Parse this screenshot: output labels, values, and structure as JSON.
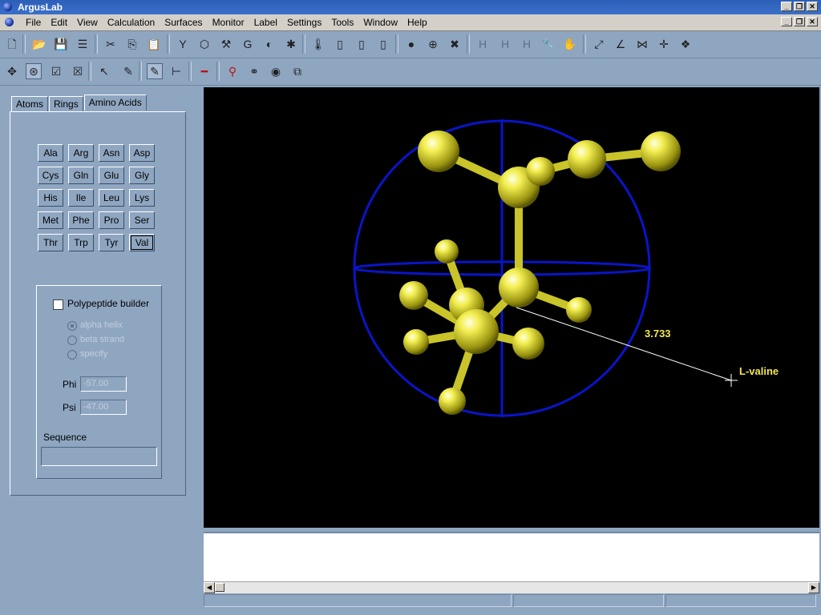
{
  "app": {
    "title": "ArgusLab"
  },
  "window_buttons": [
    "_",
    "❐",
    "✕"
  ],
  "menu": [
    "File",
    "Edit",
    "View",
    "Calculation",
    "Surfaces",
    "Monitor",
    "Label",
    "Settings",
    "Tools",
    "Window",
    "Help"
  ],
  "toolbar1": [
    {
      "name": "new-file-icon",
      "glyph": "🗋"
    },
    {
      "name": "open-folder-icon",
      "glyph": "📂"
    },
    {
      "name": "save-icon",
      "glyph": "💾"
    },
    {
      "name": "list-icon",
      "glyph": "☰"
    },
    {
      "name": "cut-icon",
      "glyph": "✂"
    },
    {
      "name": "copy-icon",
      "glyph": "⎘"
    },
    {
      "name": "paste-icon",
      "glyph": "📋"
    },
    {
      "name": "fragment-icon",
      "glyph": "Y"
    },
    {
      "name": "ring-icon",
      "glyph": "⬡"
    },
    {
      "name": "build-icon",
      "glyph": "⚒"
    },
    {
      "name": "rotate-icon",
      "glyph": "G"
    },
    {
      "name": "surface-icon",
      "glyph": "◐"
    },
    {
      "name": "molecule-icon",
      "glyph": "✱"
    },
    {
      "name": "thermometer-icon",
      "glyph": "🌡"
    },
    {
      "name": "battery-low-icon",
      "glyph": "▯"
    },
    {
      "name": "battery-mid-icon",
      "glyph": "▯"
    },
    {
      "name": "battery-high-icon",
      "glyph": "▯"
    },
    {
      "name": "atom-dot-icon",
      "glyph": "●"
    },
    {
      "name": "add-atom-icon",
      "glyph": "⊕"
    },
    {
      "name": "delete-atom-icon",
      "glyph": "✖"
    },
    {
      "name": "hydrogen-icon",
      "glyph": "H"
    },
    {
      "name": "hydrogen-edit-icon",
      "glyph": "H"
    },
    {
      "name": "hydrogen-remove-icon",
      "glyph": "H"
    },
    {
      "name": "wrench-icon",
      "glyph": "🔧"
    },
    {
      "name": "hand-icon",
      "glyph": "✋"
    },
    {
      "name": "bond-icon",
      "glyph": "⤢"
    },
    {
      "name": "angle-icon",
      "glyph": "∠"
    },
    {
      "name": "dihedral-icon",
      "glyph": "⋈"
    },
    {
      "name": "axes-icon",
      "glyph": "✛"
    },
    {
      "name": "cage-icon",
      "glyph": "❖"
    }
  ],
  "toolbar2": [
    {
      "name": "translate-icon",
      "glyph": "✥"
    },
    {
      "name": "rotate-view-icon",
      "glyph": "⊛"
    },
    {
      "name": "select-icon",
      "glyph": "☑"
    },
    {
      "name": "deselect-icon",
      "glyph": "☒"
    },
    {
      "name": "pointer-icon",
      "glyph": "↖"
    },
    {
      "name": "pencil-icon",
      "glyph": "✎"
    },
    {
      "name": "draw-bond-icon",
      "glyph": "✎"
    },
    {
      "name": "tree-icon",
      "glyph": "⊢"
    },
    {
      "name": "minus-bond-icon",
      "glyph": "━"
    },
    {
      "name": "ball-stick-icon",
      "glyph": "⚲"
    },
    {
      "name": "two-atoms-icon",
      "glyph": "⚭"
    },
    {
      "name": "colored-spheres-icon",
      "glyph": "◉"
    },
    {
      "name": "windows-icon",
      "glyph": "⧉"
    }
  ],
  "tabs": [
    "Atoms",
    "Rings",
    "Amino Acids"
  ],
  "amino_acids": [
    "Ala",
    "Arg",
    "Asn",
    "Asp",
    "Cys",
    "Gln",
    "Glu",
    "Gly",
    "His",
    "Ile",
    "Leu",
    "Lys",
    "Met",
    "Phe",
    "Pro",
    "Ser",
    "Thr",
    "Trp",
    "Tyr",
    "Val"
  ],
  "polypeptide": {
    "checkbox_label": "Polypeptide builder",
    "options": [
      "alpha helix",
      "beta strand",
      "specify"
    ],
    "phi_label": "Phi",
    "phi_value": "-57.00",
    "psi_label": "Psi",
    "psi_value": "-47.00",
    "sequence_label": "Sequence"
  },
  "viewport": {
    "distance_label": "3.733",
    "molecule_label": "L-valine",
    "colors": {
      "atom": "#e6e234",
      "sphere": "#0a14c8",
      "label": "#f2e64c"
    }
  }
}
